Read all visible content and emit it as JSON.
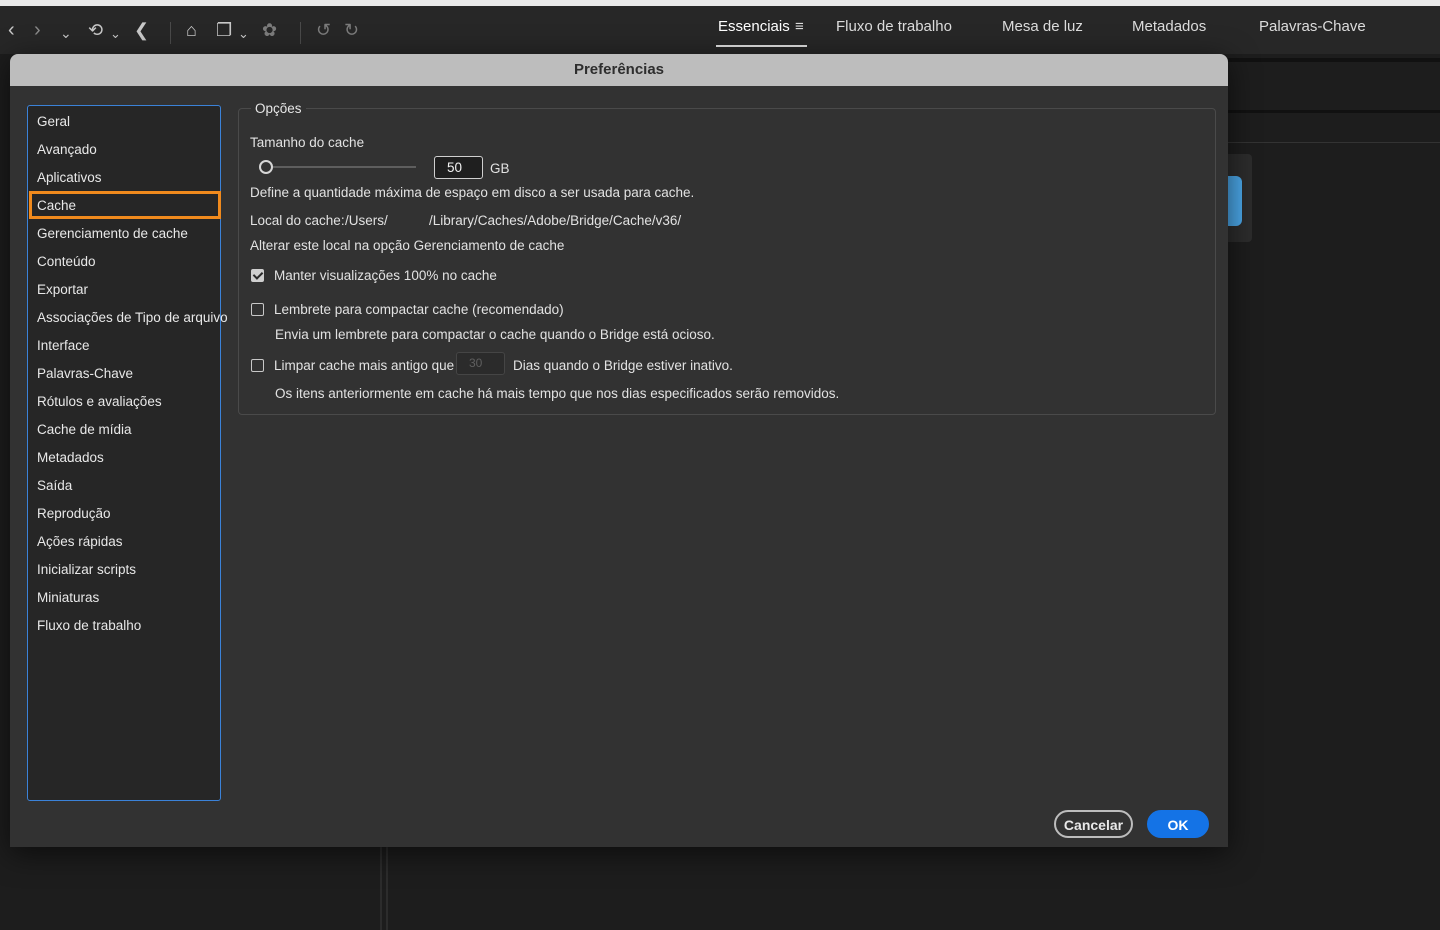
{
  "toolbar": {
    "icons": [
      "chevron-left-icon",
      "chevron-right-icon",
      "chevron-down-icon",
      "recent-icon",
      "boomerang-icon",
      "camera-icon",
      "copy-icon",
      "refine-icon",
      "rotate-left-icon",
      "rotate-right-icon"
    ]
  },
  "workspaces": {
    "items": [
      "Essenciais",
      "Fluxo de trabalho",
      "Mesa de luz",
      "Metadados",
      "Palavras-Chave"
    ],
    "active": "Essenciais",
    "menu_glyph": "≡"
  },
  "dialog": {
    "title": "Preferências",
    "categories": [
      "Geral",
      "Avançado",
      "Aplicativos",
      "Cache",
      "Gerenciamento de cache",
      "Conteúdo",
      "Exportar",
      "Associações de Tipo de arquivo",
      "Interface",
      "Palavras-Chave",
      "Rótulos e avaliações",
      "Cache de mídia",
      "Metadados",
      "Saída",
      "Reprodução",
      "Ações rápidas",
      "Inicializar scripts",
      "Miniaturas",
      "Fluxo de trabalho"
    ],
    "selected_category": "Cache",
    "options": {
      "legend": "Opções",
      "cache_size_label": "Tamanho do cache",
      "cache_size_value": "50",
      "cache_size_unit": "GB",
      "cache_size_slider_fraction": 0.0,
      "cache_size_desc": "Define a quantidade máxima de espaço em disco a ser usada para cache.",
      "cache_location_label": "Local do cache:",
      "cache_location_user": "/Users/",
      "cache_location_path": "/Library/Caches/Adobe/Bridge/Cache/v36/",
      "cache_location_hint": "Alterar este local na opção Gerenciamento de cache",
      "keep_previews_label": "Manter visualizações 100% no cache",
      "keep_previews_checked": true,
      "compact_reminder_label": "Lembrete para compactar cache (recomendado)",
      "compact_reminder_checked": false,
      "compact_reminder_desc": "Envia um lembrete para compactar o cache quando o Bridge está ocioso.",
      "purge_older_label": "Limpar cache mais antigo que",
      "purge_older_checked": false,
      "purge_days_value": "30",
      "purge_days_suffix": "Dias quando o Bridge estiver inativo.",
      "purge_desc": "Os itens anteriormente em cache há mais tempo que nos dias especificados serão removidos."
    },
    "buttons": {
      "cancel": "Cancelar",
      "ok": "OK"
    }
  },
  "colors": {
    "accent_blue": "#1473e6",
    "highlight_orange": "#f08a1d"
  }
}
